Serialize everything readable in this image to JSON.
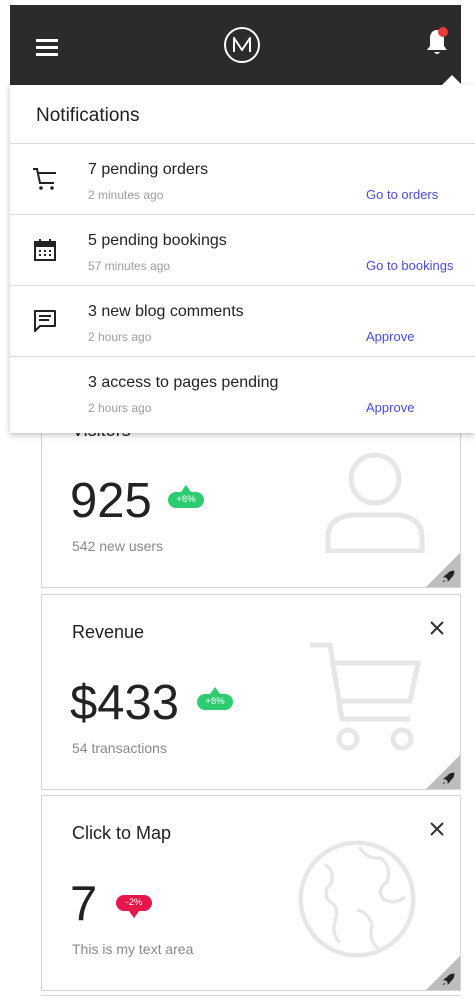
{
  "header": {
    "menu_icon": "hamburger-menu-icon",
    "logo_icon": "nm-logo-icon",
    "notification_icon": "bell-icon",
    "notification_dot_color": "#ea3a3a",
    "bar_color": "#2b2b2b"
  },
  "notifications": {
    "title": "Notifications",
    "items": [
      {
        "icon": "cart-icon",
        "title": "7 pending orders",
        "time": "2 minutes ago",
        "action": "Go to orders"
      },
      {
        "icon": "calendar-icon",
        "title": "5 pending bookings",
        "time": "57 minutes ago",
        "action": "Go to bookings"
      },
      {
        "icon": "comment-icon",
        "title": "3 new blog comments",
        "time": "2 hours ago",
        "action": "Approve"
      },
      {
        "icon": "",
        "title": "3 access to pages pending",
        "time": "2 hours ago",
        "action": "Approve"
      }
    ],
    "action_color": "#4a4dd9"
  },
  "cards": [
    {
      "title": "Visitors",
      "value": "925",
      "badge": "+8%",
      "trend": "up",
      "subtitle": "542 new users",
      "watermark": "user-icon"
    },
    {
      "title": "Revenue",
      "value": "$433",
      "badge": "+8%",
      "trend": "up",
      "subtitle": "54 transactions",
      "watermark": "cart-icon"
    },
    {
      "title": "Click to Map",
      "value": "7",
      "badge": "-2%",
      "trend": "down",
      "subtitle": "This is my text area",
      "watermark": "globe-icon"
    }
  ],
  "colors": {
    "badge_up": "#2ecc71",
    "badge_down": "#e8174b"
  }
}
